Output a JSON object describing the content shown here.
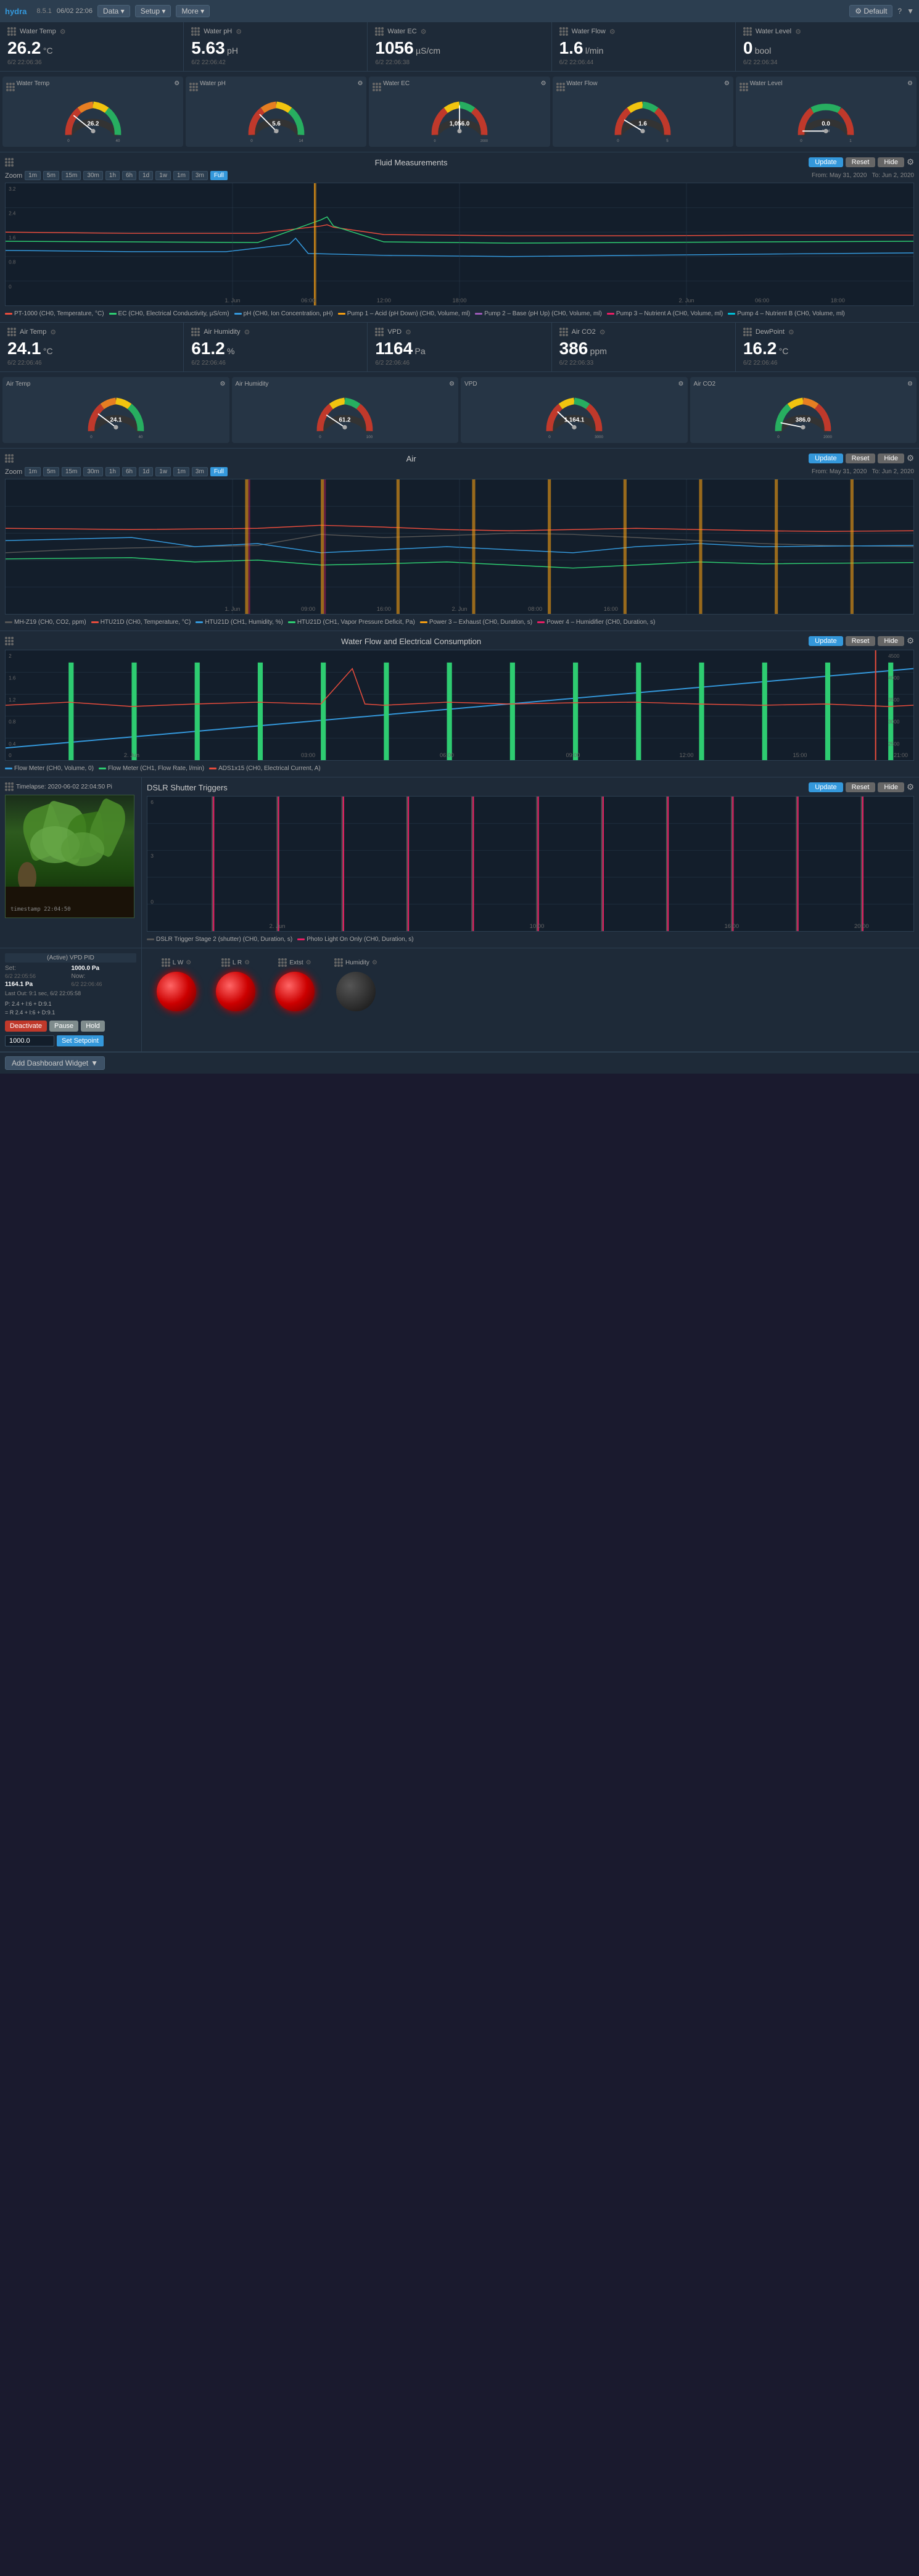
{
  "app": {
    "name": "hydra",
    "version": "8.5.1",
    "date": "06/02 22:06",
    "nav_items": [
      "Data",
      "Setup",
      "More",
      "Default"
    ]
  },
  "water_metrics": [
    {
      "id": "water-temp",
      "label": "Water Temp",
      "value": "26.2",
      "unit": "°C",
      "time": "6/2 22:06:36",
      "min": 0,
      "max": 40,
      "current": 26.2,
      "color": "#e74c3c"
    },
    {
      "id": "water-ph",
      "label": "Water pH",
      "value": "5.63",
      "unit": "pH",
      "time": "6/2 22:06:42",
      "min": 0,
      "max": 14,
      "current": 5.63,
      "color": "#f39c12"
    },
    {
      "id": "water-ec",
      "label": "Water EC",
      "value": "1056",
      "unit": "µS/cm",
      "time": "6/2 22:06:38",
      "min": 0,
      "max": 2000,
      "current": 1056,
      "color": "#2ecc71"
    },
    {
      "id": "water-flow",
      "label": "Water Flow",
      "value": "1.6",
      "unit": "l/min",
      "time": "6/2 22:06:44",
      "min": 0,
      "max": 5,
      "current": 1.6,
      "color": "#3498db"
    },
    {
      "id": "water-level",
      "label": "Water Level",
      "value": "0",
      "unit": "bool",
      "time": "6/2 22:06:34",
      "min": 0,
      "max": 1,
      "current": 0,
      "color": "#9b59b6"
    }
  ],
  "fluid_chart": {
    "title": "Fluid Measurements",
    "zoom_options": [
      "1m",
      "5m",
      "15m",
      "30m",
      "1h",
      "6h",
      "1d",
      "1w",
      "1m",
      "3m",
      "Full"
    ],
    "active_zoom": "Full",
    "from": "May 31, 2020",
    "to": "Jun 2, 2020",
    "legend": [
      {
        "label": "PT-1000 (CH0, Temperature, °C)",
        "color": "#e74c3c"
      },
      {
        "label": "EC (CH0, Electrical Conductivity, µS/cm)",
        "color": "#2ecc71"
      },
      {
        "label": "pH (CH0, Ion Concentration, pH)",
        "color": "#3498db"
      },
      {
        "label": "Pump 1 – Acid (pH Down) (CH0, Volume, ml)",
        "color": "#f39c12"
      },
      {
        "label": "Pump 2 – Base (pH Up) (CH0, Volume, ml)",
        "color": "#9b59b6"
      },
      {
        "label": "Pump 3 – Nutrient A (CH0, Volume, ml)",
        "color": "#e91e63"
      },
      {
        "label": "Pump 4 – Nutrient B (CH0, Volume, ml)",
        "color": "#00bcd4"
      }
    ]
  },
  "air_metrics": [
    {
      "id": "air-temp",
      "label": "Air Temp",
      "value": "24.1",
      "unit": "°C",
      "time": "6/2 22:06:46",
      "min": 0,
      "max": 40,
      "current": 24.1,
      "color": "#e74c3c"
    },
    {
      "id": "air-humidity",
      "label": "Air Humidity",
      "value": "61.2",
      "unit": "%",
      "time": "6/2 22:06:46",
      "min": 0,
      "max": 100,
      "current": 61.2,
      "color": "#3498db"
    },
    {
      "id": "vpd",
      "label": "VPD",
      "value": "1164",
      "unit": "Pa",
      "time": "6/2 22:06:46",
      "min": 0,
      "max": 3000,
      "current": 1164,
      "color": "#2ecc71"
    },
    {
      "id": "air-co2",
      "label": "Air CO2",
      "value": "386",
      "unit": "ppm",
      "time": "6/2 22:06:33",
      "min": 0,
      "max": 2000,
      "current": 386,
      "color": "#f39c12"
    },
    {
      "id": "dewpoint",
      "label": "DewPoint",
      "value": "16.2",
      "unit": "°C",
      "time": "6/2 22:06:46",
      "min": 0,
      "max": 40,
      "current": 16.2,
      "color": "#9b59b6"
    }
  ],
  "air_chart": {
    "title": "Air",
    "zoom_options": [
      "1m",
      "5m",
      "15m",
      "30m",
      "1h",
      "6h",
      "1d",
      "1w",
      "1m",
      "3m",
      "Full"
    ],
    "active_zoom": "Full",
    "from": "May 31, 2020",
    "to": "Jun 2, 2020",
    "legend": [
      {
        "label": "MH-Z19 (CH0, CO2, ppm)",
        "color": "#222"
      },
      {
        "label": "HTU21D (CH0, Temperature, °C)",
        "color": "#e74c3c"
      },
      {
        "label": "HTU21D (CH1, Humidity, %)",
        "color": "#3498db"
      },
      {
        "label": "HTU21D (CH1, Vapor Pressure Deficit, Pa)",
        "color": "#2ecc71"
      },
      {
        "label": "Power 3 – Exhaust (CH0, Duration, s)",
        "color": "#f39c12"
      },
      {
        "label": "Power 4 – Humidifier (CH0, Duration, s)",
        "color": "#e91e63"
      }
    ]
  },
  "waterflow_chart": {
    "title": "Water Flow and Electrical Consumption",
    "legend": [
      {
        "label": "Flow Meter (CH0, Volume, 0)",
        "color": "#3498db"
      },
      {
        "label": "Flow Meter (CH1, Flow Rate, l/min)",
        "color": "#2ecc71"
      },
      {
        "label": "ADS1x15 (CH0, Electrical Current, A)",
        "color": "#e74c3c"
      }
    ]
  },
  "timelapse": {
    "title": "Timelapse: 2020-06-02 22:04:50 Pi"
  },
  "dslr_chart": {
    "title": "DSLR Shutter Triggers",
    "legend": [
      {
        "label": "DSLR Trigger Stage 2 (shutter) (CH0, Duration, s)",
        "color": "#555"
      },
      {
        "label": "Photo Light On Only (CH0, Duration, s)",
        "color": "#e91e63"
      }
    ]
  },
  "pid": {
    "title": "(Active) VPD PID",
    "set_label": "Set:",
    "set_value": "1000.0 Pa",
    "now_label": "Now:",
    "now_value": "1164.1 Pa",
    "set_time": "6/2 22:05:56",
    "now_time": "6/2 22:06:46",
    "last_out_label": "Last Out:",
    "last_out_value": "9:1 sec, 6/2 22:05:58",
    "formula": "P: 2.4 + I:6 + D:9.1",
    "formula2": "= R 2.4 + I:6 + D:9.1",
    "btn_deactivate": "Deactivate",
    "btn_pause": "Pause",
    "btn_hold": "Hold",
    "setpoint_value": "1000.0",
    "btn_set": "Set Setpoint"
  },
  "indicators": [
    {
      "id": "lw",
      "label": "L W",
      "active": true,
      "color": "red"
    },
    {
      "id": "lr",
      "label": "L R",
      "active": true,
      "color": "red"
    },
    {
      "id": "extst",
      "label": "Extst",
      "active": true,
      "color": "red"
    },
    {
      "id": "hum",
      "label": "Hum",
      "active": false,
      "color": "dark"
    }
  ],
  "add_widget": {
    "label": "Add Dashboard Widget",
    "dropdown_icon": "▼"
  },
  "humidity_label": "Humidity"
}
